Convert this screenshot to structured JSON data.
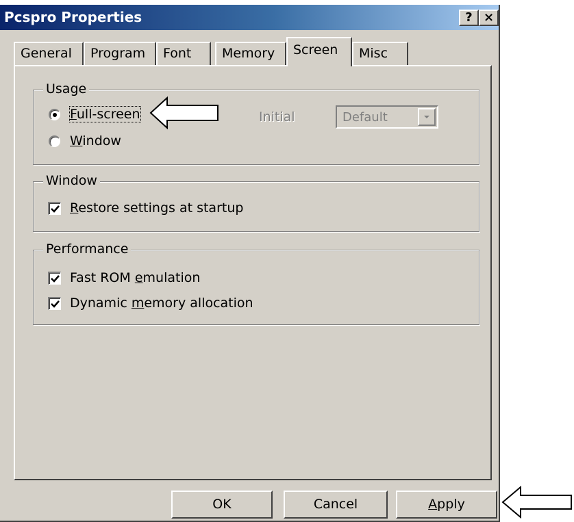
{
  "window": {
    "title": "Pcspro Properties",
    "help_button": "?",
    "close_button": "×"
  },
  "tabs": [
    {
      "label": "General",
      "active": false
    },
    {
      "label": "Program",
      "active": false
    },
    {
      "label": "Font",
      "active": false
    },
    {
      "label": "Memory",
      "active": false
    },
    {
      "label": "Screen",
      "active": true
    },
    {
      "label": "Misc",
      "active": false
    }
  ],
  "usage": {
    "legend": "Usage",
    "full_screen_label": "Full-screen",
    "full_screen_mnemonic": "F",
    "full_screen_rest": "ull-screen",
    "full_screen_selected": true,
    "window_label": "Window",
    "window_mnemonic": "W",
    "window_rest": "indow",
    "window_selected": false,
    "initial_label": "Initial",
    "initial_value": "Default"
  },
  "window_group": {
    "legend": "Window",
    "restore_mnemonic": "R",
    "restore_rest": "estore settings at startup",
    "restore_checked": true
  },
  "performance": {
    "legend": "Performance",
    "fast_rom_pre": "Fast ROM ",
    "fast_rom_mnemonic": "e",
    "fast_rom_rest": "mulation",
    "fast_rom_checked": true,
    "dynamic_pre": "Dynamic ",
    "dynamic_mnemonic": "m",
    "dynamic_rest": "emory allocation",
    "dynamic_checked": true
  },
  "buttons": {
    "ok": "OK",
    "cancel": "Cancel",
    "apply_mnemonic": "A",
    "apply_rest": "pply"
  }
}
